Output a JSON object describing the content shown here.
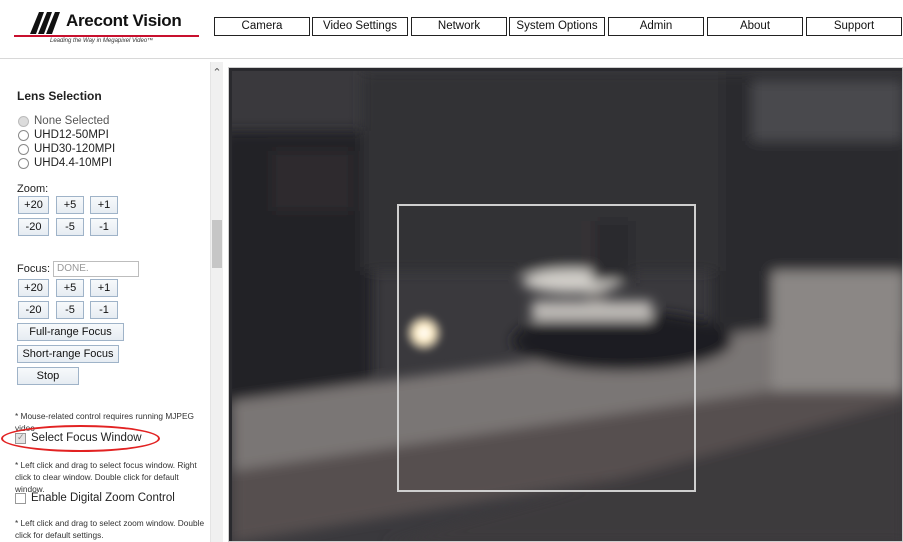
{
  "header": {
    "logo_text": "Arecont Vision",
    "logo_tagline": "Leading the Way in Megapixel Video™",
    "nav": [
      "Camera",
      "Video Settings",
      "Network",
      "System Options",
      "Admin",
      "About",
      "Support"
    ]
  },
  "lens": {
    "title": "Lens Selection",
    "options": [
      "None Selected",
      "UHD12-50MPI",
      "UHD30-120MPI",
      "UHD4.4-10MPI"
    ]
  },
  "zoom": {
    "label": "Zoom:",
    "buttons_row1": [
      "+20",
      "+5",
      "+1"
    ],
    "buttons_row2": [
      "-20",
      "-5",
      "-1"
    ]
  },
  "focus": {
    "label": "Focus:",
    "status": "DONE.",
    "buttons_row1": [
      "+20",
      "+5",
      "+1"
    ],
    "buttons_row2": [
      "-20",
      "-5",
      "-1"
    ],
    "full_range": "Full-range Focus",
    "short_range": "Short-range Focus",
    "stop": "Stop"
  },
  "notes": {
    "mouse": "* Mouse-related control requires running MJPEG video",
    "focus_window": "* Left click and drag to select focus window. Right click to clear window. Double click for default window.",
    "zoom_window": "* Left click and drag to select zoom window. Double click for default settings."
  },
  "checkboxes": {
    "select_focus_window": "Select Focus Window",
    "enable_digital_zoom": "Enable Digital Zoom Control"
  },
  "colors": {
    "highlight": "#e22222",
    "logo_rule": "#c8102e"
  },
  "icons": {
    "scroll_up": "chevron-up-icon"
  }
}
